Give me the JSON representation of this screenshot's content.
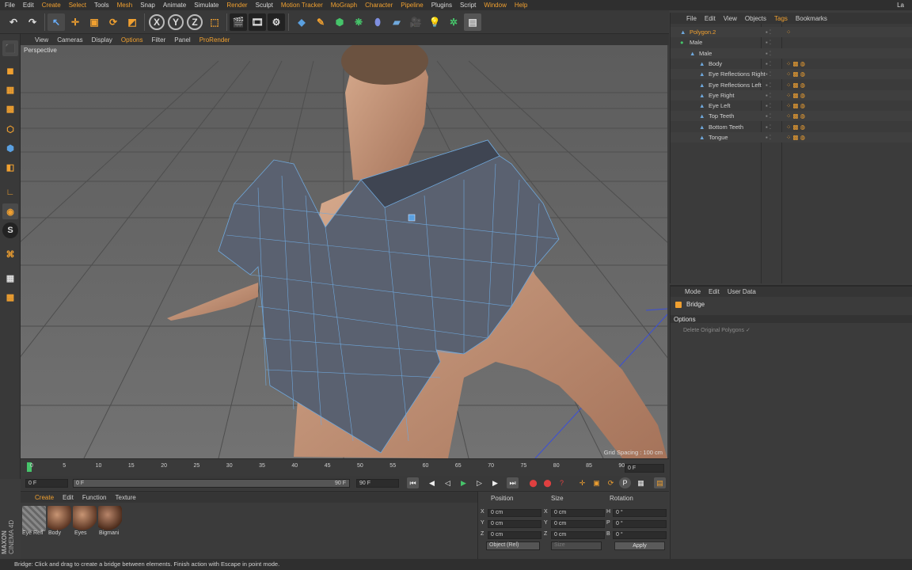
{
  "menubar": {
    "items": [
      "File",
      "Edit",
      "Create",
      "Select",
      "Tools",
      "Mesh",
      "Snap",
      "Animate",
      "Simulate",
      "Render",
      "Sculpt",
      "Motion Tracker",
      "MoGraph",
      "Character",
      "Pipeline",
      "Plugins",
      "Script",
      "Window",
      "Help"
    ],
    "layout_label": "La"
  },
  "viewport": {
    "menu": [
      "View",
      "Cameras",
      "Display",
      "Options",
      "Filter",
      "Panel",
      "ProRender"
    ],
    "label": "Perspective",
    "grid_spacing": "Grid Spacing : 100 cm"
  },
  "timeline": {
    "ticks": [
      "0",
      "5",
      "10",
      "15",
      "20",
      "25",
      "30",
      "35",
      "40",
      "45",
      "50",
      "55",
      "60",
      "65",
      "70",
      "75",
      "80",
      "85",
      "90"
    ],
    "frame_field": "0 F"
  },
  "playbar": {
    "start": "0 F",
    "range_start": "0 F",
    "range_end": "90 F",
    "end": "90 F"
  },
  "materials": {
    "menu": [
      "Create",
      "Edit",
      "Function",
      "Texture"
    ],
    "items": [
      "Eye Refl",
      "Body",
      "Eyes",
      "Bigmani"
    ]
  },
  "coords": {
    "headers": [
      "Position",
      "Size",
      "Rotation"
    ],
    "rows": [
      {
        "axis": "X",
        "pos": "0 cm",
        "size_axis": "X",
        "size": "0 cm",
        "rot_axis": "H",
        "rot": "0 °"
      },
      {
        "axis": "Y",
        "pos": "0 cm",
        "size_axis": "Y",
        "size": "0 cm",
        "rot_axis": "P",
        "rot": "0 °"
      },
      {
        "axis": "Z",
        "pos": "0 cm",
        "size_axis": "Z",
        "size": "0 cm",
        "rot_axis": "B",
        "rot": "0 °"
      }
    ],
    "mode_select": "Object (Rel)",
    "size_select": "Size",
    "apply": "Apply"
  },
  "objects": {
    "menu": [
      "File",
      "Edit",
      "View",
      "Objects",
      "Tags",
      "Bookmarks"
    ],
    "rows": [
      {
        "name": "Polygon.2",
        "indent": 0,
        "selected": true
      },
      {
        "name": "Male",
        "indent": 0,
        "selected": false
      },
      {
        "name": "Male",
        "indent": 1,
        "selected": false
      },
      {
        "name": "Body",
        "indent": 2,
        "selected": false
      },
      {
        "name": "Eye Reflections Right",
        "indent": 2,
        "selected": false
      },
      {
        "name": "Eye Reflections Left",
        "indent": 2,
        "selected": false
      },
      {
        "name": "Eye Right",
        "indent": 2,
        "selected": false
      },
      {
        "name": "Eye Left",
        "indent": 2,
        "selected": false
      },
      {
        "name": "Top Teeth",
        "indent": 2,
        "selected": false
      },
      {
        "name": "Bottom Teeth",
        "indent": 2,
        "selected": false
      },
      {
        "name": "Tongue",
        "indent": 2,
        "selected": false
      }
    ]
  },
  "attributes": {
    "menu": [
      "Mode",
      "Edit",
      "User Data"
    ],
    "tool_name": "Bridge",
    "section": "Options",
    "option": "Delete Original Polygons ✓"
  },
  "brand": {
    "line1": "MAXON",
    "line2": "CINEMA 4D"
  },
  "status": "Bridge: Click and drag to create a bridge between elements. Finish action with Escape in point mode.",
  "colors": {
    "accent": "#f0a030",
    "mesh": "#5a6170",
    "wire": "#6fa8dc",
    "skin": "#c99a7e"
  }
}
